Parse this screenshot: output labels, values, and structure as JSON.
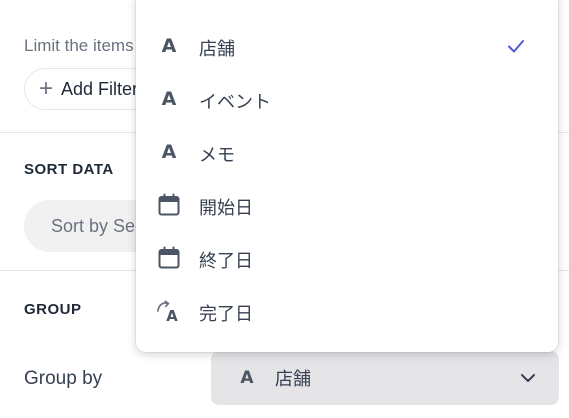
{
  "filter": {
    "description": "Limit the items",
    "add_filter_label": "Add Filter"
  },
  "sort": {
    "section_title": "SORT DATA",
    "sort_placeholder": "Sort by Sele"
  },
  "group": {
    "section_title": "GROUP",
    "group_by_label": "Group by",
    "selected_field": "店舗",
    "selected_field_icon": "text-type-icon"
  },
  "dropdown": {
    "accent_color": "#4f5bd5",
    "items": [
      {
        "label": "店舗",
        "icon": "text-type-icon",
        "selected": true
      },
      {
        "label": "イベント",
        "icon": "text-type-icon",
        "selected": false
      },
      {
        "label": "メモ",
        "icon": "text-type-icon",
        "selected": false
      },
      {
        "label": "開始日",
        "icon": "calendar-icon",
        "selected": false
      },
      {
        "label": "終了日",
        "icon": "calendar-icon",
        "selected": false
      },
      {
        "label": "完了日",
        "icon": "formula-text-icon",
        "selected": false
      }
    ]
  }
}
